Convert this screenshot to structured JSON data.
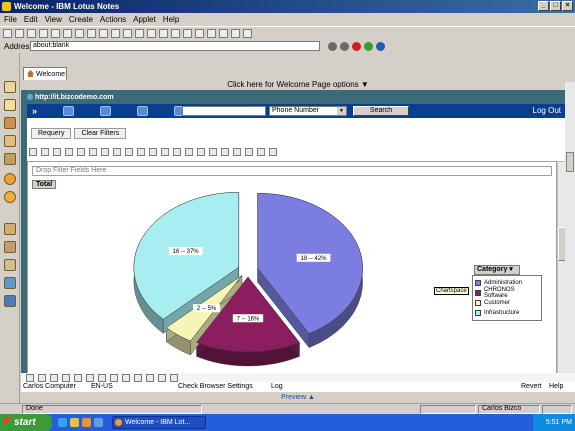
{
  "window": {
    "title": "Welcome - IBM Lotus Notes",
    "controls": [
      "_",
      "□",
      "×"
    ]
  },
  "menu": [
    "File",
    "Edit",
    "View",
    "Create",
    "Actions",
    "Applet",
    "Help"
  ],
  "address": {
    "label": "Address",
    "value": "about:blank"
  },
  "tab": {
    "label": "Welcome"
  },
  "welcome_options": "Click here for Welcome Page options ▼",
  "url": "http://it.bizcodemo.com",
  "portal": {
    "chevron": "»",
    "search_select": "Phone Number",
    "search_button": "Search",
    "logout": "Log Out"
  },
  "buttons": {
    "requery": "Requery",
    "clear_filters": "Clear Filters"
  },
  "pivot": {
    "drop_filter": "Drop Filter Fields Here",
    "total": "Total",
    "chartspace_tip": "Chartspace"
  },
  "chart_data": {
    "type": "pie",
    "slices": [
      {
        "name": "Administration",
        "value": 18,
        "label": "18 -- 42%",
        "color": "#7b7ee0"
      },
      {
        "name": "CHRONOS Software",
        "value": 7,
        "label": "7 -- 16%",
        "color": "#8a1e5e"
      },
      {
        "name": "Customer",
        "value": 2,
        "label": "2 -- 5%",
        "color": "#f7f4b8"
      },
      {
        "name": "Infrastructure",
        "value": 16,
        "label": "16 -- 37%",
        "color": "#a8eef0"
      }
    ],
    "legend_title": "Category",
    "legend_placement": "right"
  },
  "status": {
    "user": "Carlos Computer",
    "locale": "EN-US",
    "check": "Check Browser Settings",
    "log": "Log",
    "revert": "Revert",
    "help": "Help"
  },
  "preview": "Preview ▲",
  "notes_status": {
    "done": "Done",
    "user": "Carlos Bizco"
  },
  "taskbar": {
    "start": "start",
    "task": "Welcome - IBM Lot...",
    "clock": "5:51 PM"
  }
}
